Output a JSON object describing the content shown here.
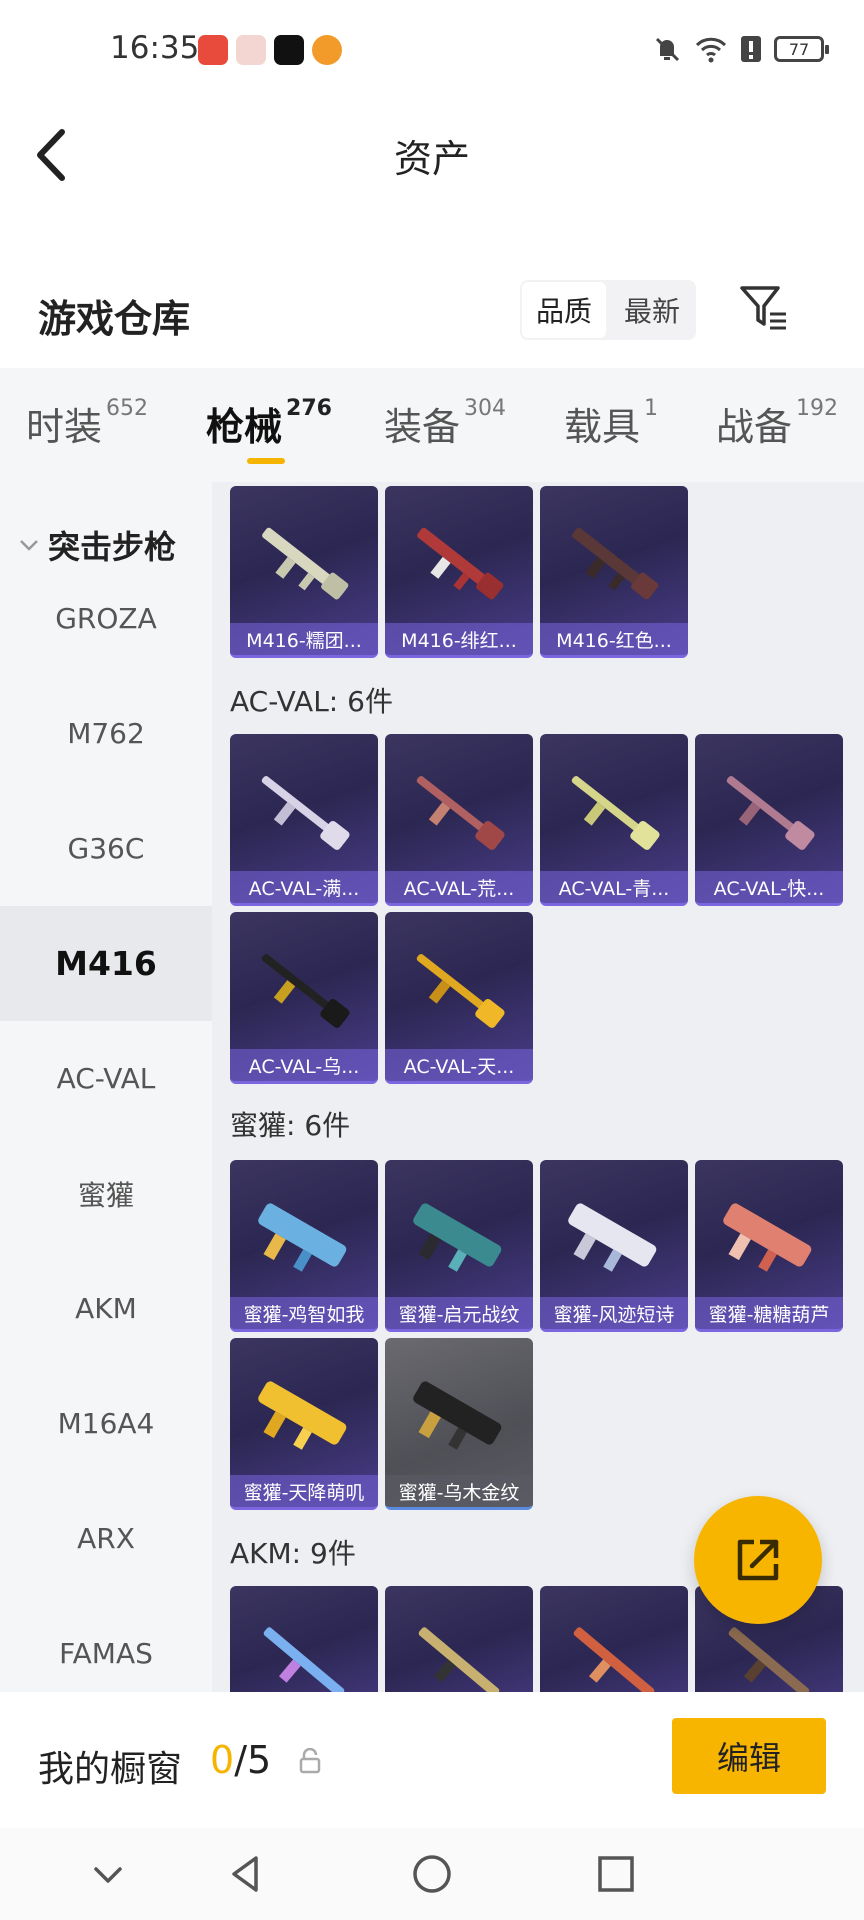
{
  "status_bar": {
    "time": "16:35",
    "battery": "77"
  },
  "header": {
    "title": "资产"
  },
  "warehouse": {
    "title": "游戏仓库",
    "sort_options": [
      "品质",
      "最新"
    ]
  },
  "tabs": [
    {
      "label": "时装",
      "count": "652"
    },
    {
      "label": "枪械",
      "count": "276"
    },
    {
      "label": "装备",
      "count": "304"
    },
    {
      "label": "载具",
      "count": "1"
    },
    {
      "label": "战备",
      "count": "192"
    }
  ],
  "sidebar": {
    "group": "突击步枪",
    "items": [
      "GROZA",
      "M762",
      "G36C",
      "M416",
      "AC-VAL",
      "蜜獾",
      "AKM",
      "M16A4",
      "ARX",
      "FAMAS"
    ]
  },
  "sections": [
    {
      "title": "",
      "items": [
        "M416-糯团...",
        "M416-绯红...",
        "M416-红色..."
      ]
    },
    {
      "title": "AC-VAL: 6件",
      "items": [
        "AC-VAL-满...",
        "AC-VAL-荒...",
        "AC-VAL-青...",
        "AC-VAL-快...",
        "AC-VAL-乌...",
        "AC-VAL-天..."
      ]
    },
    {
      "title": "蜜獾: 6件",
      "items": [
        "蜜獾-鸡智如我",
        "蜜獾-启元战纹",
        "蜜獾-风迹短诗",
        "蜜獾-糖糖葫芦",
        "蜜獾-天降萌叽",
        "蜜獾-乌木金纹"
      ]
    },
    {
      "title": "AKM: 9件",
      "items": [
        "",
        "",
        "",
        ""
      ]
    }
  ],
  "bottom": {
    "showcase_label": "我的橱窗",
    "showcase_current": "0",
    "showcase_total": "/5",
    "edit_label": "编辑"
  },
  "colors": {
    "accent": "#f7b500",
    "card_purple": "#2c2752",
    "card_border": "#7b66e0"
  }
}
